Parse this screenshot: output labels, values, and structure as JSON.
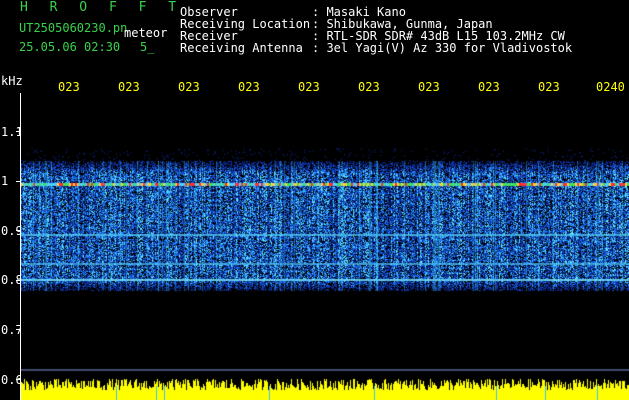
{
  "header": {
    "title": "H R O F F T",
    "filename": "UT2505060230.pn",
    "tag": "meteor",
    "datetime": "25.05.06 02:30",
    "flag": "5_",
    "info": [
      {
        "label": "Observer",
        "value": ": Masaki Kano"
      },
      {
        "label": "Receiving Location",
        "value": ": Shibukawa, Gunma, Japan"
      },
      {
        "label": "Receiver",
        "value": ": RTL-SDR SDR# 43dB L15 103.2MHz CW"
      },
      {
        "label": "Receiving Antenna",
        "value": ": 3el Yagi(V) Az 330 for Vladivostok"
      }
    ]
  },
  "axis": {
    "unit": "kHz",
    "y_ticks": [
      "1.1",
      "1",
      "0.9",
      "0.8",
      "0.7",
      "0.6"
    ],
    "x_ticks": [
      "023",
      "023",
      "023",
      "023",
      "023",
      "023",
      "023",
      "023",
      "023",
      "0240"
    ]
  },
  "colors": {
    "title": "#39d24b",
    "time_labels": "#ffff00",
    "text": "#ffffff",
    "background": "#000000",
    "noise_low": "#0b2a9e",
    "noise_high": "#3cc8ff",
    "echo": "#ff3030",
    "bottom_strip": "#ffff00"
  }
}
